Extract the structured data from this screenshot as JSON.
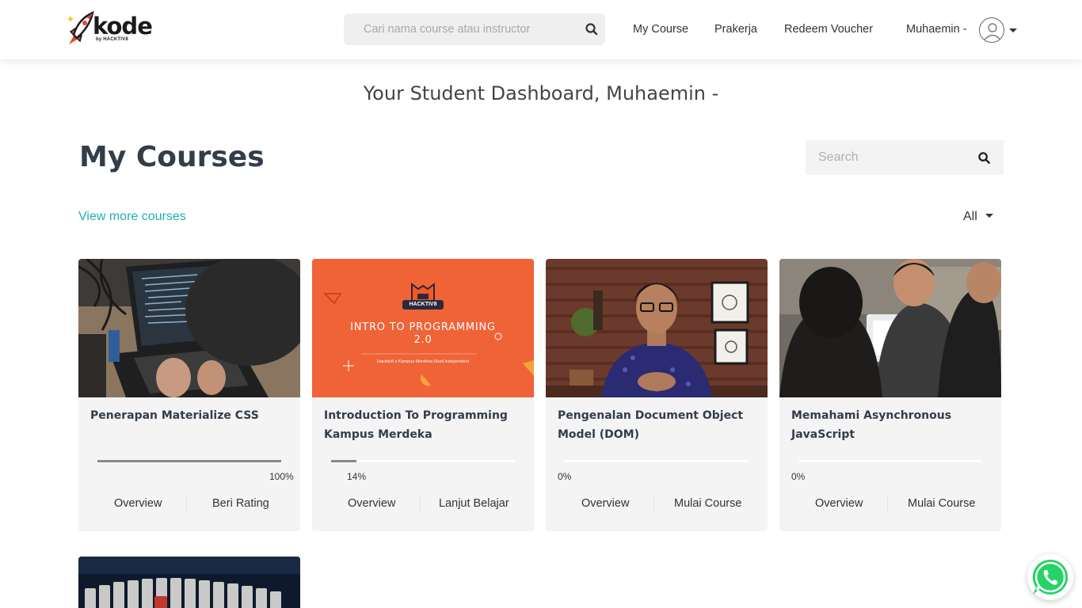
{
  "brand": {
    "name": "kode",
    "sub": "by HACKTIV8",
    "accent": "#1fb1b2"
  },
  "header": {
    "search_placeholder": "Cari nama course atau instructor",
    "nav": [
      "My Course",
      "Prakerja",
      "Redeem Voucher"
    ],
    "user_name": "Muhaemin -"
  },
  "dashboard_title": "Your Student Dashboard, Muhaemin -",
  "section": {
    "title": "My Courses",
    "search_placeholder": "Search",
    "view_more": "View more courses",
    "filter": "All"
  },
  "courses": [
    {
      "title": "Penerapan Materialize CSS",
      "progress": 100,
      "progress_label": "100%",
      "btn_left": "Overview",
      "btn_right": "Beri Rating",
      "thumb": "photo-laptop-hood"
    },
    {
      "title": "Introduction To Programming Kampus Merdeka",
      "progress": 14,
      "progress_label": "14%",
      "btn_left": "Overview",
      "btn_right": "Lanjut Belajar",
      "thumb": "banner-orange",
      "banner_badge": "HACKTIV8",
      "banner_title": "INTRO TO PROGRAMMING 2.0",
      "banner_sub": "Hacktiv8 x Kampus Merdeka Studi Independent"
    },
    {
      "title": "Pengenalan Document Object Model (DOM)",
      "progress": 0,
      "progress_label": "0%",
      "btn_left": "Overview",
      "btn_right": "Mulai Course",
      "thumb": "photo-instructor"
    },
    {
      "title": "Memahami Asynchronous JavaScript",
      "progress": 0,
      "progress_label": "0%",
      "btn_left": "Overview",
      "btn_right": "Mulai Course",
      "thumb": "photo-group"
    }
  ],
  "extra_card_thumb": "photo-keyboard",
  "whatsapp": {
    "icon": "whatsapp-icon",
    "color": "#25d366"
  }
}
